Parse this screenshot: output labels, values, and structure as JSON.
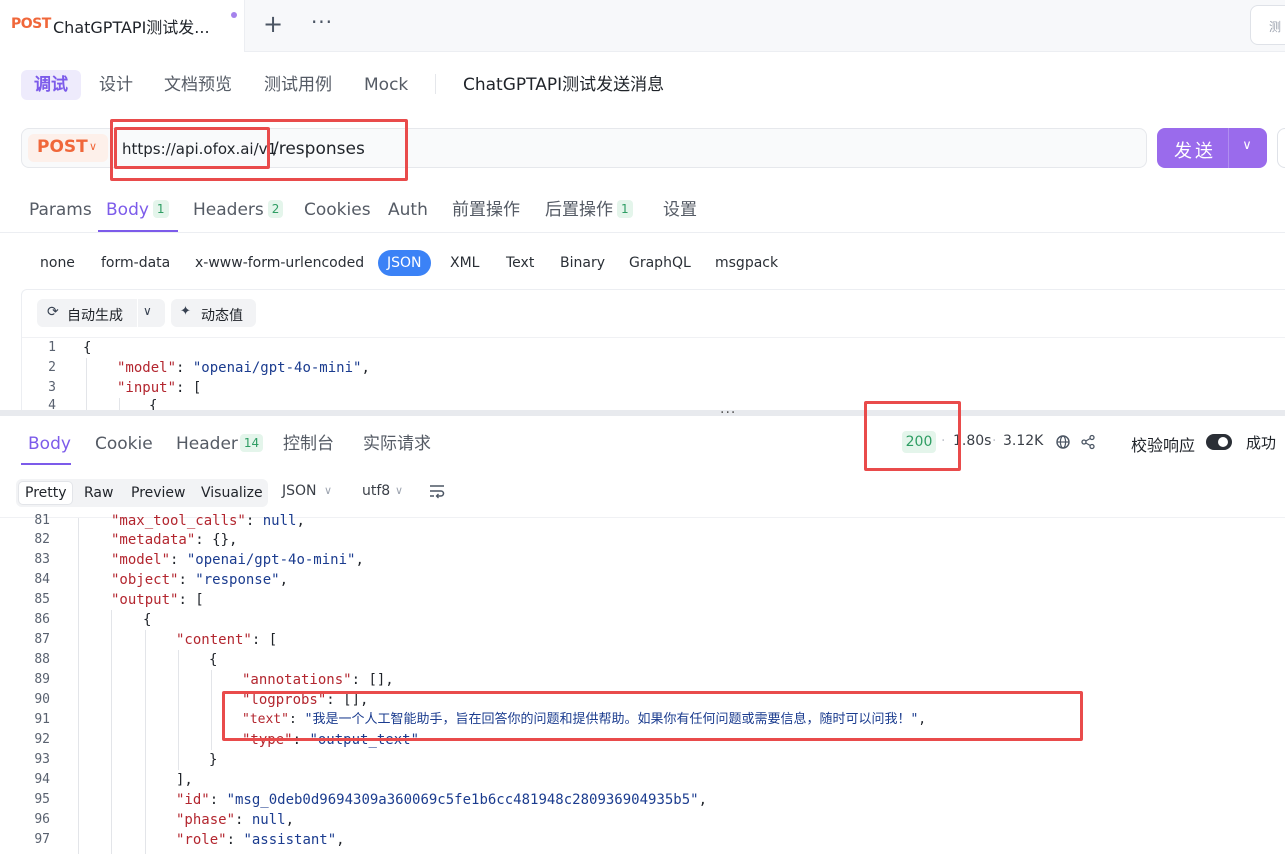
{
  "tab": {
    "method": "POST",
    "title": "ChatGPTAPI测试发..."
  },
  "env_button": "测",
  "subtabs": [
    "调试",
    "设计",
    "文档预览",
    "测试用例",
    "Mock"
  ],
  "api_name": "ChatGPTAPI测试发送消息",
  "request": {
    "method": "POST",
    "base_url": "https://api.ofox.ai/v1",
    "path": "/responses",
    "send_label": "发送"
  },
  "request_tabs": [
    {
      "label": "Params",
      "badge": ""
    },
    {
      "label": "Body",
      "badge": "1"
    },
    {
      "label": "Headers",
      "badge": "2"
    },
    {
      "label": "Cookies",
      "badge": ""
    },
    {
      "label": "Auth",
      "badge": ""
    },
    {
      "label": "前置操作",
      "badge": ""
    },
    {
      "label": "后置操作",
      "badge": "1"
    },
    {
      "label": "设置",
      "badge": ""
    }
  ],
  "body_types": [
    "none",
    "form-data",
    "x-www-form-urlencoded",
    "JSON",
    "XML",
    "Text",
    "Binary",
    "GraphQL",
    "msgpack"
  ],
  "body_toolbar": {
    "auto_generate": "自动生成",
    "dynamic_value": "动态值"
  },
  "request_code": [
    {
      "ln": "1",
      "text": "{"
    },
    {
      "ln": "2",
      "key": "\"model\"",
      "val": "\"openai/gpt-4o-mini\"",
      "tail": ","
    },
    {
      "ln": "3",
      "key": "\"input\"",
      "val": "[",
      "tail": ""
    },
    {
      "ln": "4",
      "text": "{"
    }
  ],
  "response_tabs": [
    {
      "label": "Body",
      "badge": ""
    },
    {
      "label": "Cookie",
      "badge": ""
    },
    {
      "label": "Header",
      "badge": "14"
    },
    {
      "label": "控制台",
      "badge": ""
    },
    {
      "label": "实际请求",
      "badge": ""
    }
  ],
  "response_meta": {
    "status": "200",
    "time": "1.80s",
    "size": "3.12K",
    "validate_label": "校验响应",
    "result": "成功"
  },
  "view_modes": [
    "Pretty",
    "Raw",
    "Preview",
    "Visualize"
  ],
  "format": "JSON",
  "encoding": "utf8",
  "response_code": [
    {
      "ln": "81",
      "key": "\"max_tool_calls\"",
      "val": "null",
      "tail": ","
    },
    {
      "ln": "82",
      "key": "\"metadata\"",
      "val": "{}",
      "tail": ","
    },
    {
      "ln": "83",
      "key": "\"model\"",
      "val": "\"openai/gpt-4o-mini\"",
      "tail": ","
    },
    {
      "ln": "84",
      "key": "\"object\"",
      "val": "\"response\"",
      "tail": ","
    },
    {
      "ln": "85",
      "key": "\"output\"",
      "val": "[",
      "tail": ""
    },
    {
      "ln": "86",
      "text": "{"
    },
    {
      "ln": "87",
      "key": "\"content\"",
      "val": "[",
      "tail": ""
    },
    {
      "ln": "88",
      "text": "{"
    },
    {
      "ln": "89",
      "key": "\"annotations\"",
      "val": "[]",
      "tail": ","
    },
    {
      "ln": "90",
      "key": "\"logprobs\"",
      "val": "[]",
      "tail": ","
    },
    {
      "ln": "91",
      "key": "\"text\"",
      "val": "\"我是一个人工智能助手，旨在回答你的问题和提供帮助。如果你有任何问题或需要信息，随时可以问我！\"",
      "tail": ","
    },
    {
      "ln": "92",
      "key": "\"type\"",
      "val": "\"output_text\"",
      "tail": ""
    },
    {
      "ln": "93",
      "text": "}"
    },
    {
      "ln": "94",
      "text": "],"
    },
    {
      "ln": "95",
      "key": "\"id\"",
      "val": "\"msg_0deb0d9694309a360069c5fe1b6cc481948c280936904935b5\"",
      "tail": ","
    },
    {
      "ln": "96",
      "key": "\"phase\"",
      "val": "null",
      "tail": ","
    },
    {
      "ln": "97",
      "key": "\"role\"",
      "val": "\"assistant\"",
      "tail": ","
    }
  ]
}
